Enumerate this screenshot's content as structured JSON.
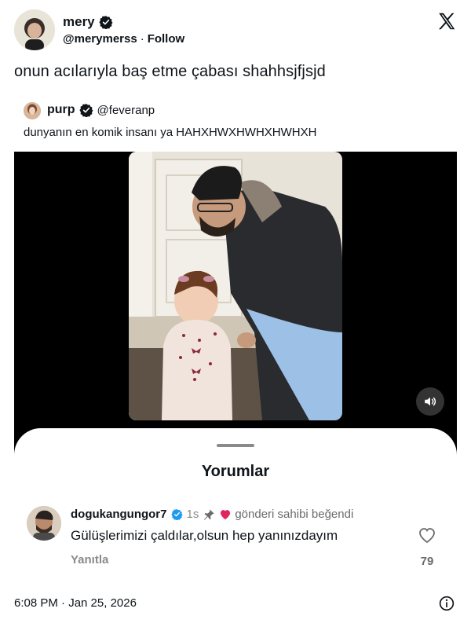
{
  "author": {
    "name": "mery",
    "handle": "@merymerss",
    "separator": "·",
    "follow_label": "Follow"
  },
  "tweet": {
    "text": "onun acılarıyla baş etme çabası shahhsjfjsjd"
  },
  "quoted": {
    "name": "purp",
    "handle": "@feveranp",
    "text": "dunyanın en komik insanı ya HAHXHWXHWHXHWHXH"
  },
  "comments_sheet": {
    "title": "Yorumlar"
  },
  "comment": {
    "username": "dogukangungor7",
    "time": "1s",
    "liked_by_author": "gönderi sahibi beğendi",
    "text": "Gülüşlerimizi çaldılar,olsun hep yanınızdayım",
    "reply_label": "Yanıtla",
    "like_count": "79"
  },
  "footer": {
    "timestamp": "6:08 PM · Jan 25, 2026"
  },
  "colors": {
    "verified_blue": "#1d9bf0",
    "heart_red": "#e0245e",
    "text": "#0f1419",
    "muted": "#8a8a8a"
  },
  "icons": [
    "verified-badge-icon",
    "x-logo-icon",
    "speaker-icon",
    "pin-icon",
    "heart-icon",
    "info-icon"
  ]
}
